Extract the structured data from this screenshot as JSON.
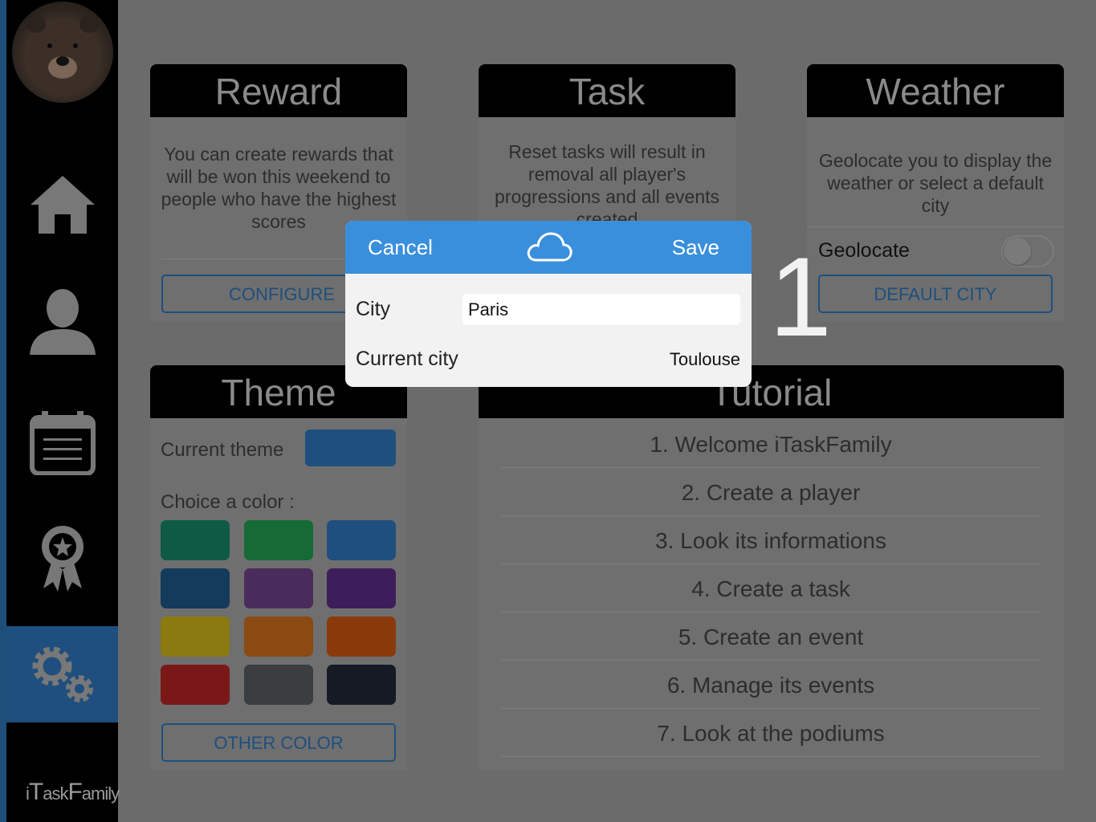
{
  "brand": {
    "prefix": "i",
    "t": "T",
    "ask": "ask",
    "f": "F",
    "amily": "amily"
  },
  "reward": {
    "title": "Reward",
    "text": "You can create rewards that will be won this weekend to people who have the highest scores",
    "button": "CONFIGURE"
  },
  "task": {
    "title": "Task",
    "text": "Reset tasks will result in removal all player's progressions and all events created"
  },
  "weather": {
    "title": "Weather",
    "text": "Geolocate you to display the weather or select a default city",
    "geolocate_label": "Geolocate",
    "geolocate_on": false,
    "button": "DEFAULT CITY"
  },
  "theme": {
    "title": "Theme",
    "current_label": "Current theme",
    "current_color": "#1f4f7e",
    "choice_label": "Choice a color :",
    "colors": [
      "#0e5a45",
      "#166a35",
      "#1f4f7e",
      "#143a5c",
      "#4a2c5c",
      "#3d1e5a",
      "#8a7a10",
      "#8a4a12",
      "#8a3a0a",
      "#7a1818",
      "#3a3e40",
      "#151a24"
    ],
    "button": "OTHER COLOR"
  },
  "tutorial": {
    "title": "Tutorial",
    "items": [
      "1. Welcome iTaskFamily",
      "2. Create a player",
      "3. Look its informations",
      "4. Create a task",
      "5. Create an event",
      "6. Manage its events",
      "7. Look at the podiums"
    ]
  },
  "dialog": {
    "cancel": "Cancel",
    "save": "Save",
    "city_label": "City",
    "city_value": "Paris",
    "current_city_label": "Current city",
    "current_city_value": "Toulouse"
  },
  "overlay_number": "1",
  "colors": {
    "accent": "#3a8fdc",
    "brand": "#1f4f7e"
  }
}
